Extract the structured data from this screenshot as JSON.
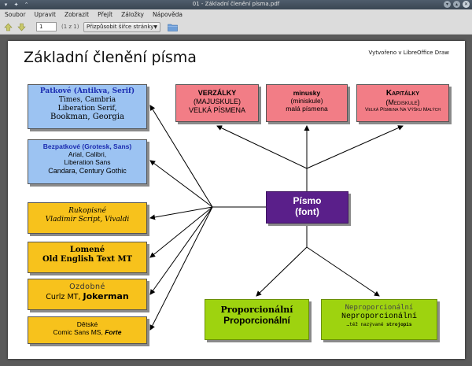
{
  "window": {
    "title": "01 - Základní členění písma.pdf"
  },
  "menu": [
    "Soubor",
    "Upravit",
    "Zobrazit",
    "Přejít",
    "Záložky",
    "Nápověda"
  ],
  "toolbar": {
    "page_value": "1",
    "page_count": "(1 z 1)",
    "zoom_label": "Přizpůsobit šířce stránky"
  },
  "document": {
    "title": "Základní členění písma",
    "credit": "Vytvořeno v LibreOffice Draw",
    "serif": {
      "heading": "Patkové (Antikva, Serif)",
      "line1": "Times, Cambria",
      "line2": "Liberation Serif,",
      "line3": "Bookman, Georgia"
    },
    "sans": {
      "heading": "Bezpatkové (Grotesk, Sans)",
      "line1": "Arial, Calibri,",
      "line2": "Liberation Sans",
      "line3": "Candara, Century Gothic"
    },
    "script": {
      "line1": "Rukopisné",
      "line2": "Vladimir Script, Vivaldi"
    },
    "broken": {
      "line1": "Lomené",
      "line2": "Old English Text MT"
    },
    "decorative": {
      "line1": "Ozdobné",
      "line2a": "Curlz MT, ",
      "line2b": "Jokerman"
    },
    "kids": {
      "line1": "Dětské",
      "line2a": "Comic Sans MS, ",
      "line2b": "Forte"
    },
    "upper": {
      "heading": "VERZÁLKY",
      "line1": "(MAJUSKULE)",
      "line2": "VELKÁ PÍSMENA"
    },
    "lower": {
      "heading": "minusky",
      "line1": "(miniskule)",
      "line2": "malá písmena"
    },
    "smallcaps": {
      "heading": "Kapitálky",
      "line1": "(Mediskule)",
      "line2": "Velká Písmena Na Výšku Malých"
    },
    "center": {
      "line1": "Písmo",
      "line2": "(font)"
    },
    "proportional": {
      "line1": "Proporcionální",
      "line2": "Proporcionální"
    },
    "monospace": {
      "line1": "Neproporcionální",
      "line2": "Neproporcionální",
      "line3a": "…též nazývané ",
      "line3b": "strojopis"
    }
  }
}
